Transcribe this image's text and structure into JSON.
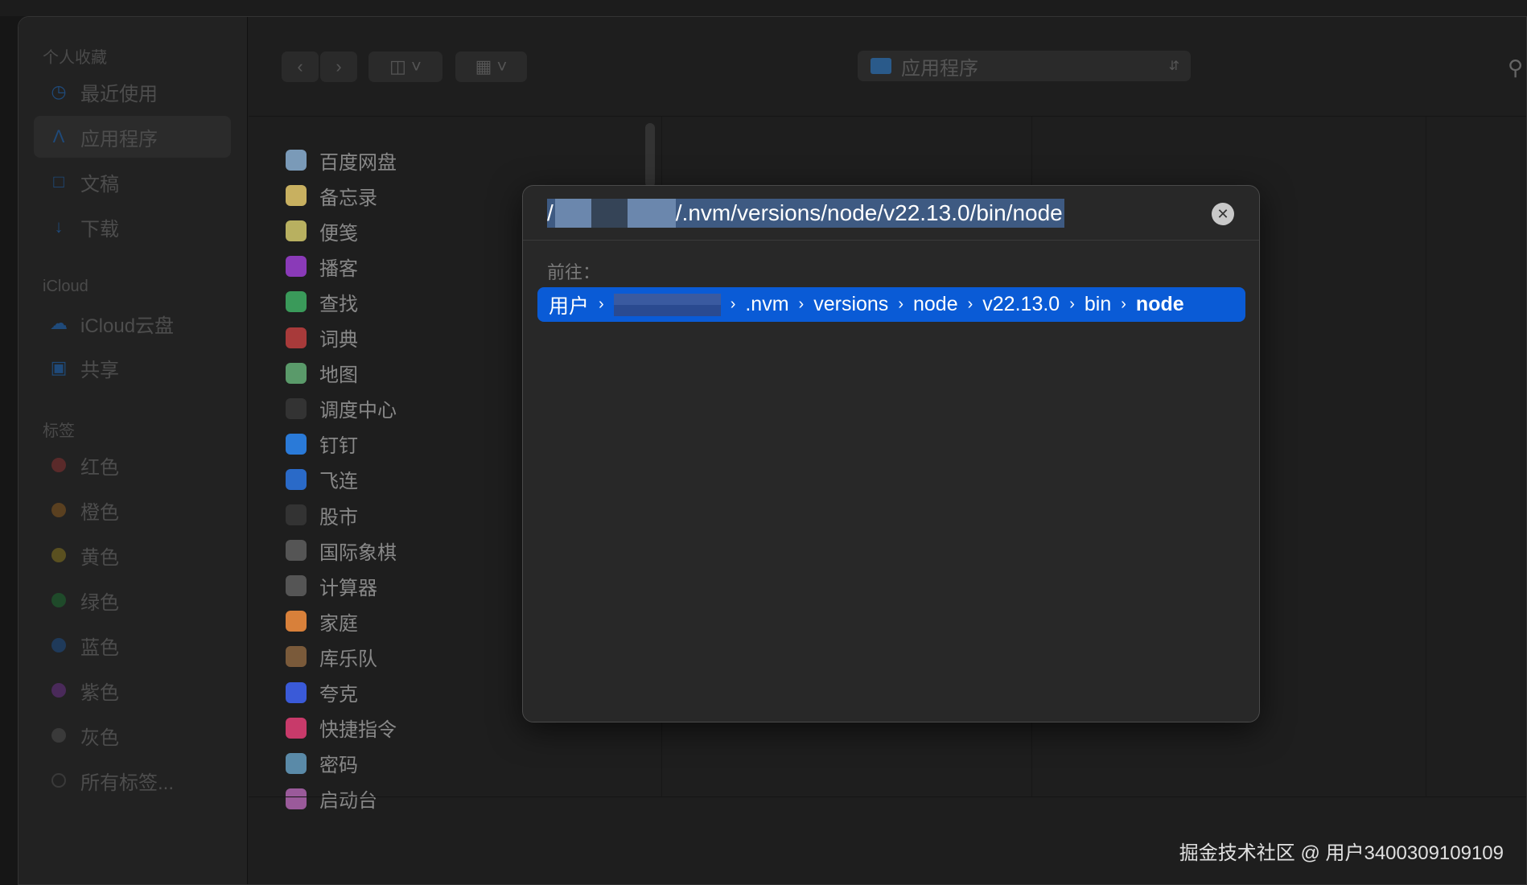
{
  "sidebar": {
    "favorites_label": "个人收藏",
    "favorites": [
      {
        "label": "最近使用",
        "icon": "clock-icon"
      },
      {
        "label": "应用程序",
        "icon": "apps-icon",
        "selected": true
      },
      {
        "label": "文稿",
        "icon": "document-icon"
      },
      {
        "label": "下载",
        "icon": "download-icon"
      }
    ],
    "icloud_label": "iCloud",
    "icloud": [
      {
        "label": "iCloud云盘",
        "icon": "cloud-icon"
      },
      {
        "label": "共享",
        "icon": "shared-folder-icon"
      }
    ],
    "tags_label": "标签",
    "tags": [
      {
        "label": "红色",
        "color": "#5a2a2a"
      },
      {
        "label": "橙色",
        "color": "#5a4020"
      },
      {
        "label": "黄色",
        "color": "#5a5020"
      },
      {
        "label": "绿色",
        "color": "#1f4a2a"
      },
      {
        "label": "蓝色",
        "color": "#1f3a5a"
      },
      {
        "label": "紫色",
        "color": "#4a2a5a"
      },
      {
        "label": "灰色",
        "color": "#3a3a3a"
      },
      {
        "label": "所有标签...",
        "color": "none"
      }
    ]
  },
  "toolbar": {
    "location": "应用程序"
  },
  "apps": [
    {
      "name": "百度网盘",
      "color": "#7a9ab8"
    },
    {
      "name": "备忘录",
      "color": "#c8b060"
    },
    {
      "name": "便笺",
      "color": "#b8b060"
    },
    {
      "name": "播客",
      "color": "#8a3ab8"
    },
    {
      "name": "查找",
      "color": "#3a9a5a"
    },
    {
      "name": "词典",
      "color": "#a83a3a"
    },
    {
      "name": "地图",
      "color": "#5a9a6a"
    },
    {
      "name": "调度中心",
      "color": "#333"
    },
    {
      "name": "钉钉",
      "color": "#2a7ad8"
    },
    {
      "name": "飞连",
      "color": "#2a6ac8"
    },
    {
      "name": "股市",
      "color": "#333"
    },
    {
      "name": "国际象棋",
      "color": "#555"
    },
    {
      "name": "计算器",
      "color": "#555"
    },
    {
      "name": "家庭",
      "color": "#d8803a"
    },
    {
      "name": "库乐队",
      "color": "#7a5a3a"
    },
    {
      "name": "夸克",
      "color": "#3a5ad8"
    },
    {
      "name": "快捷指令",
      "color": "#c83a6a"
    },
    {
      "name": "密码",
      "color": "#5a8aa8"
    },
    {
      "name": "启动台",
      "color": "#9a5a9a"
    }
  ],
  "dialog": {
    "path_text": "/.nvm/versions/node/v22.13.0/bin/node",
    "goto_label": "前往：",
    "crumbs": [
      "用户",
      ".nvm",
      "versions",
      "node",
      "v22.13.0",
      "bin"
    ],
    "crumb_last": "node"
  },
  "watermark": "掘金技术社区 @ 用户3400309109109"
}
